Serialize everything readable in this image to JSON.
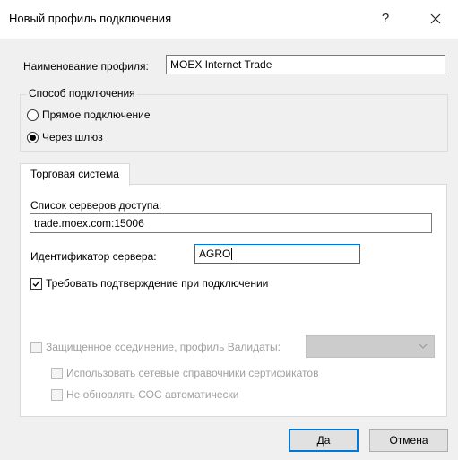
{
  "window": {
    "title": "Новый профиль подключения",
    "help_label": "?"
  },
  "profile": {
    "name_label": "Наименование профиля:",
    "name_value": "MOEX Internet Trade"
  },
  "connection_method": {
    "legend": "Способ подключения",
    "options": [
      {
        "label": "Прямое подключение",
        "selected": false
      },
      {
        "label": "Через шлюз",
        "selected": true
      }
    ]
  },
  "tabs": {
    "active_tab": "Торговая система"
  },
  "trading_system": {
    "servers_label": "Список серверов доступа:",
    "servers_value": "trade.moex.com:15006",
    "server_id_label": "Идентификатор сервера:",
    "server_id_value": "AGRO",
    "require_confirmation_label": "Требовать подтверждение при подключении",
    "require_confirmation_checked": true,
    "secure_connection_label": "Защищенное соединение, профиль Валидаты:",
    "secure_connection_checked": false,
    "secure_profile_value": "",
    "use_network_certs_label": "Использовать сетевые справочники сертификатов",
    "no_auto_update_crl_label": "Не обновлять СОС автоматически"
  },
  "buttons": {
    "ok_label": "Да",
    "cancel_label": "Отмена"
  },
  "colors": {
    "focus_blue": "#0078d7",
    "dialog_bg": "#f0f0f0",
    "disabled_text": "#a0a0a0"
  }
}
